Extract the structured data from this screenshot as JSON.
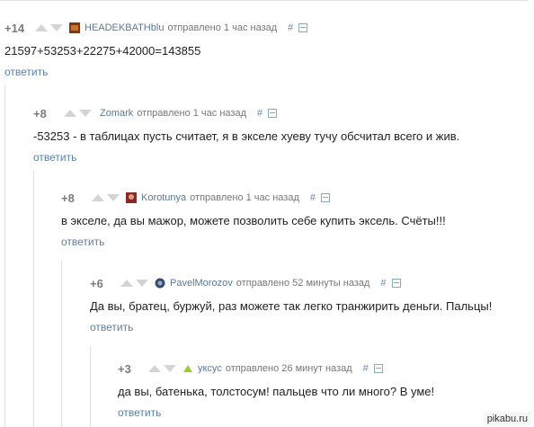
{
  "comments": [
    {
      "rating": "+14",
      "author": "HEADEKBATHblu",
      "meta": "отправлено 1 час назад",
      "hash": "#",
      "text": "21597+53253+22275+42000=143855",
      "reply": "ответить",
      "avatar_color": "#7a3a1a"
    },
    {
      "rating": "+8",
      "author": "Zomark",
      "meta": "отправлено 1 час назад",
      "hash": "#",
      "text": "-53253 - в таблицах пусть считает, я в экселе хуеву тучу обсчитал всего и жив.",
      "reply": "ответить",
      "avatar_color": ""
    },
    {
      "rating": "+8",
      "author": "Korotunya",
      "meta": "отправлено 1 час назад",
      "hash": "#",
      "text": "в экселе, да вы мажор, можете позволить себе купить эксель. Счёты!!!",
      "reply": "ответить",
      "avatar_color": "#8a2a22"
    },
    {
      "rating": "+6",
      "author": "PavelMorozov",
      "meta": "отправлено 52 минуты назад",
      "hash": "#",
      "text": "Да вы, братец, буржуй, раз можете так легко транжирить деньги. Пальцы!",
      "reply": "ответить",
      "avatar_color": "#3a4a6a"
    },
    {
      "rating": "+3",
      "author": "уксус",
      "meta": "отправлено 26 минут назад",
      "hash": "#",
      "text": "да вы, батенька, толстосум! пальцев что ли много? В уме!",
      "reply": "ответить",
      "avatar_color": "#9acd32"
    }
  ],
  "watermark": "pikabu.ru",
  "colors": {
    "author": "#5a7896",
    "reply": "#5a7ea8",
    "rating": "#7a7a7a",
    "line": "#e0e0e0"
  }
}
